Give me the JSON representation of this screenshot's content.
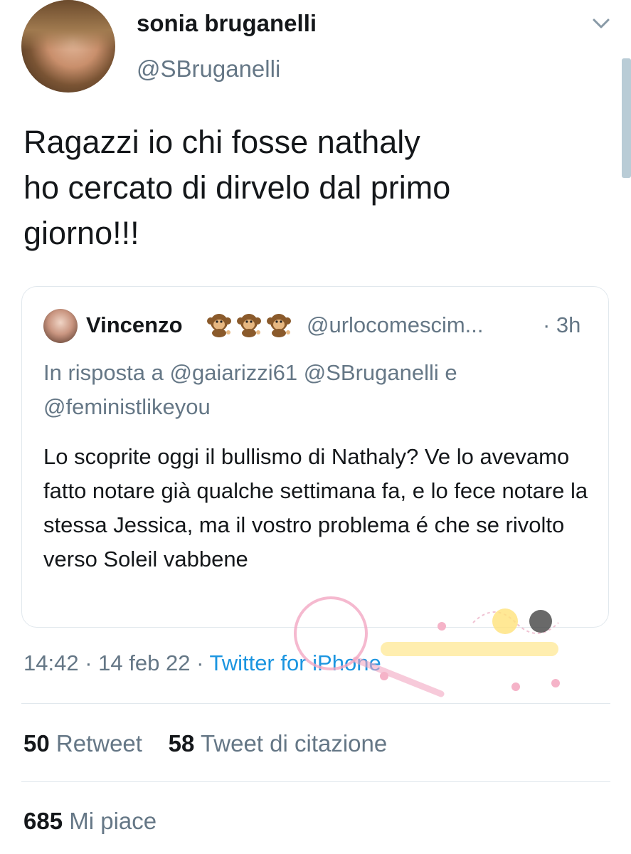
{
  "author": {
    "name": "sonia bruganelli",
    "handle": "@SBruganelli"
  },
  "tweet": {
    "text": "Ragazzi io chi fosse nathaly\nho cercato di dirvelo dal primo\ngiorno!!!"
  },
  "quoted_tweet": {
    "name": "Vincenzo",
    "emojis": [
      "monkey",
      "monkey",
      "monkey"
    ],
    "handle": "@urlocomescim...",
    "time": "· 3h",
    "reply_to": "In risposta a @gaiarizzi61 @SBruganelli e @feministlikeyou",
    "text": "Lo scoprite oggi il bullismo di Nathaly? Ve lo avevamo fatto notare già qualche settimana fa, e lo fece notare la stessa Jessica, ma il vostro problema é che se rivolto verso Soleil vabbene"
  },
  "meta": {
    "time": "14:42",
    "date": "14 feb 22",
    "sep": "·",
    "source": "Twitter for iPhone"
  },
  "stats": {
    "retweets_count": "50",
    "retweets_label": "Retweet",
    "quotes_count": "58",
    "quotes_label": "Tweet di citazione",
    "likes_count": "685",
    "likes_label": "Mi piace"
  },
  "colors": {
    "link": "#1b95e0",
    "secondary": "#657786",
    "border": "#e1e8ed"
  }
}
